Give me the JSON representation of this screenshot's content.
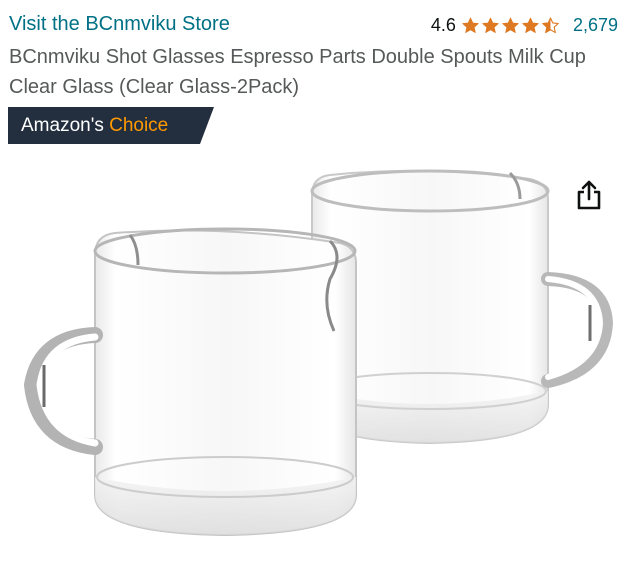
{
  "store": {
    "link_text": "Visit the BCnmviku Store"
  },
  "rating": {
    "value_text": "4.6",
    "stars_value": 4.6,
    "stars_max": 5,
    "review_count": "2,679",
    "star_color": "#de7921"
  },
  "product": {
    "title": "BCnmviku Shot Glasses Espresso Parts Double Spouts Milk Cup Clear Glass (Clear Glass-2Pack)"
  },
  "badge": {
    "prefix": "Amazon's",
    "accent": "Choice",
    "background_color": "#232f3e",
    "accent_color": "#ff9900"
  },
  "actions": {
    "share_icon": "share-icon"
  },
  "colors": {
    "link": "#007185",
    "title_text": "#565959"
  }
}
